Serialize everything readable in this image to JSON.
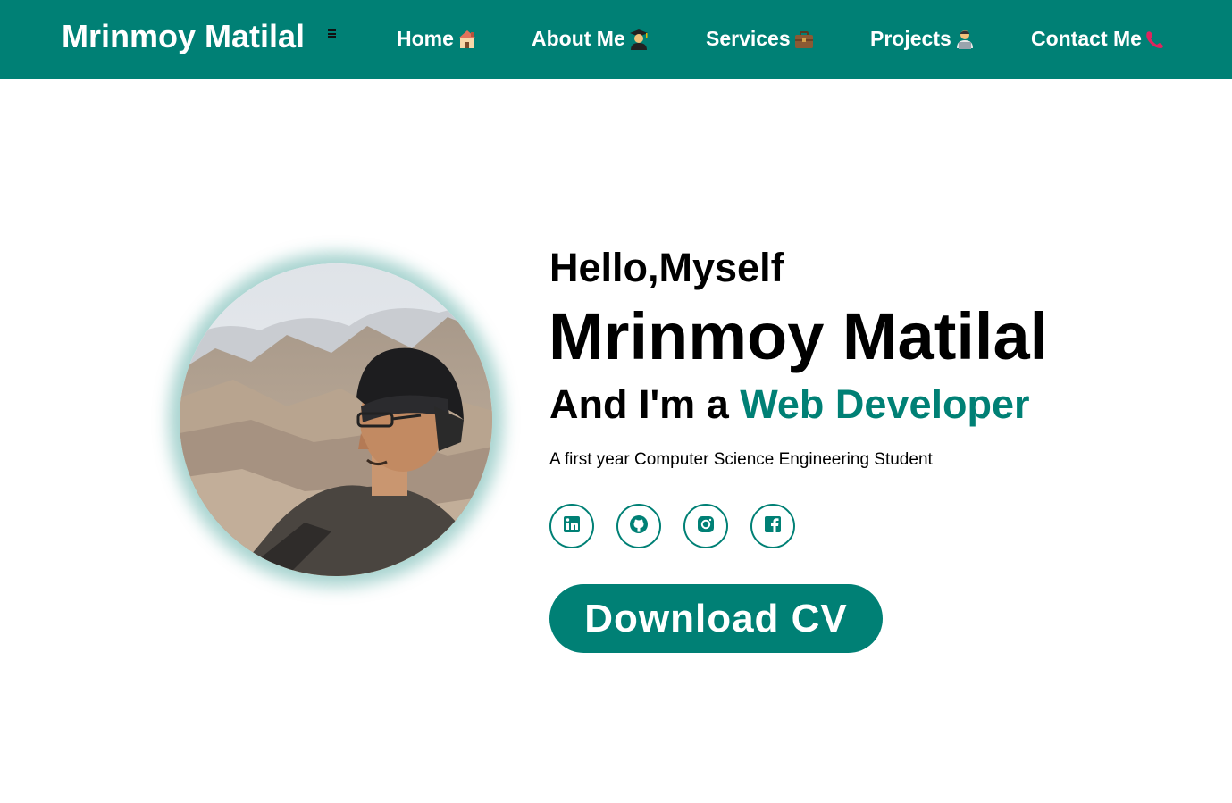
{
  "navbar": {
    "brand": "Mrinmoy Matilal",
    "links": [
      {
        "label": "Home",
        "icon": "house-icon"
      },
      {
        "label": "About Me",
        "icon": "graduate-icon"
      },
      {
        "label": "Services",
        "icon": "briefcase-icon"
      },
      {
        "label": "Projects",
        "icon": "technologist-icon"
      },
      {
        "label": "Contact Me",
        "icon": "telephone-receiver-icon"
      }
    ]
  },
  "hero": {
    "greeting": "Hello,Myself",
    "name": "Mrinmoy Matilal",
    "role_prefix": "And I'm a",
    "role": "Web Developer",
    "tagline": "A first year Computer Science Engineering Student",
    "socials": [
      "linkedin-icon",
      "github-icon",
      "instagram-icon",
      "facebook-icon"
    ],
    "cta": "Download CV"
  },
  "colors": {
    "accent": "#008075",
    "nav_background": "#008075",
    "text": "#000000",
    "background": "#ffffff"
  }
}
